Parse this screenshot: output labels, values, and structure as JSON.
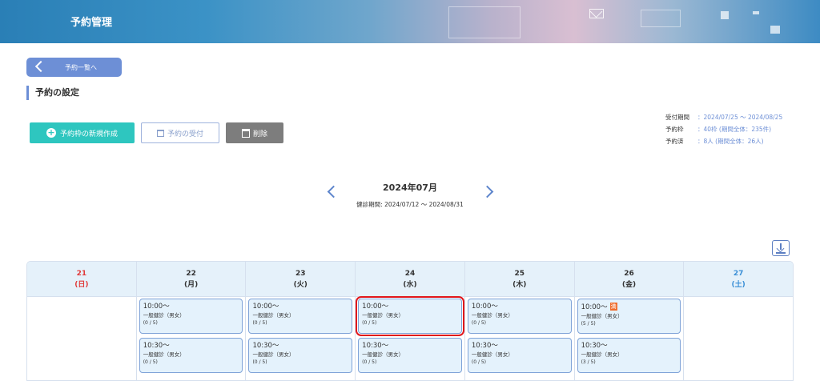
{
  "header": {
    "title": "予約管理"
  },
  "back_button": {
    "label": "予約一覧へ"
  },
  "section_title": "予約の設定",
  "toolbar": {
    "create_label": "予約枠の新規作成",
    "accept_label": "予約の受付",
    "delete_label": "削除"
  },
  "info": {
    "period_key": "受付期間",
    "period_value": "：2024/07/25 ～ 2024/08/25",
    "slots_key": "予約枠",
    "slots_value": "：40枠 (期間全体：235件)",
    "booked_key": "予約済",
    "booked_value": "：8人 (期間全体：26人)"
  },
  "month": {
    "label": "2024年07月",
    "period": "健診期間: 2024/07/12 ～ 2024/08/31"
  },
  "calendar": {
    "days": [
      {
        "date": "21",
        "dow": "(日)",
        "type": "sun"
      },
      {
        "date": "22",
        "dow": "(月)",
        "type": "wd"
      },
      {
        "date": "23",
        "dow": "(火)",
        "type": "wd"
      },
      {
        "date": "24",
        "dow": "(水)",
        "type": "wd"
      },
      {
        "date": "25",
        "dow": "(木)",
        "type": "wd"
      },
      {
        "date": "26",
        "dow": "(金)",
        "type": "wd"
      },
      {
        "date": "27",
        "dow": "(土)",
        "type": "sat"
      }
    ],
    "slots": {
      "22": [
        {
          "time": "10:00～",
          "name": "一般健診（男女）",
          "count": "(0 / 5)"
        },
        {
          "time": "10:30～",
          "name": "一般健診（男女）",
          "count": "(0 / 5)"
        }
      ],
      "23": [
        {
          "time": "10:00～",
          "name": "一般健診（男女）",
          "count": "(0 / 5)"
        },
        {
          "time": "10:30～",
          "name": "一般健診（男女）",
          "count": "(0 / 5)"
        }
      ],
      "24": [
        {
          "time": "10:00～",
          "name": "一般健診（男女）",
          "count": "(0 / 5)",
          "selected": true
        },
        {
          "time": "10:30～",
          "name": "一般健診（男女）",
          "count": "(0 / 5)"
        }
      ],
      "25": [
        {
          "time": "10:00～",
          "name": "一般健診（男女）",
          "count": "(0 / 5)"
        },
        {
          "time": "10:30～",
          "name": "一般健診（男女）",
          "count": "(0 / 5)"
        }
      ],
      "26": [
        {
          "time": "10:00～",
          "name": "一般健診（男女）",
          "count": "(5 / 5)",
          "badge": "満"
        },
        {
          "time": "10:30～",
          "name": "一般健診（男女）",
          "count": "(3 / 5)"
        }
      ]
    }
  }
}
